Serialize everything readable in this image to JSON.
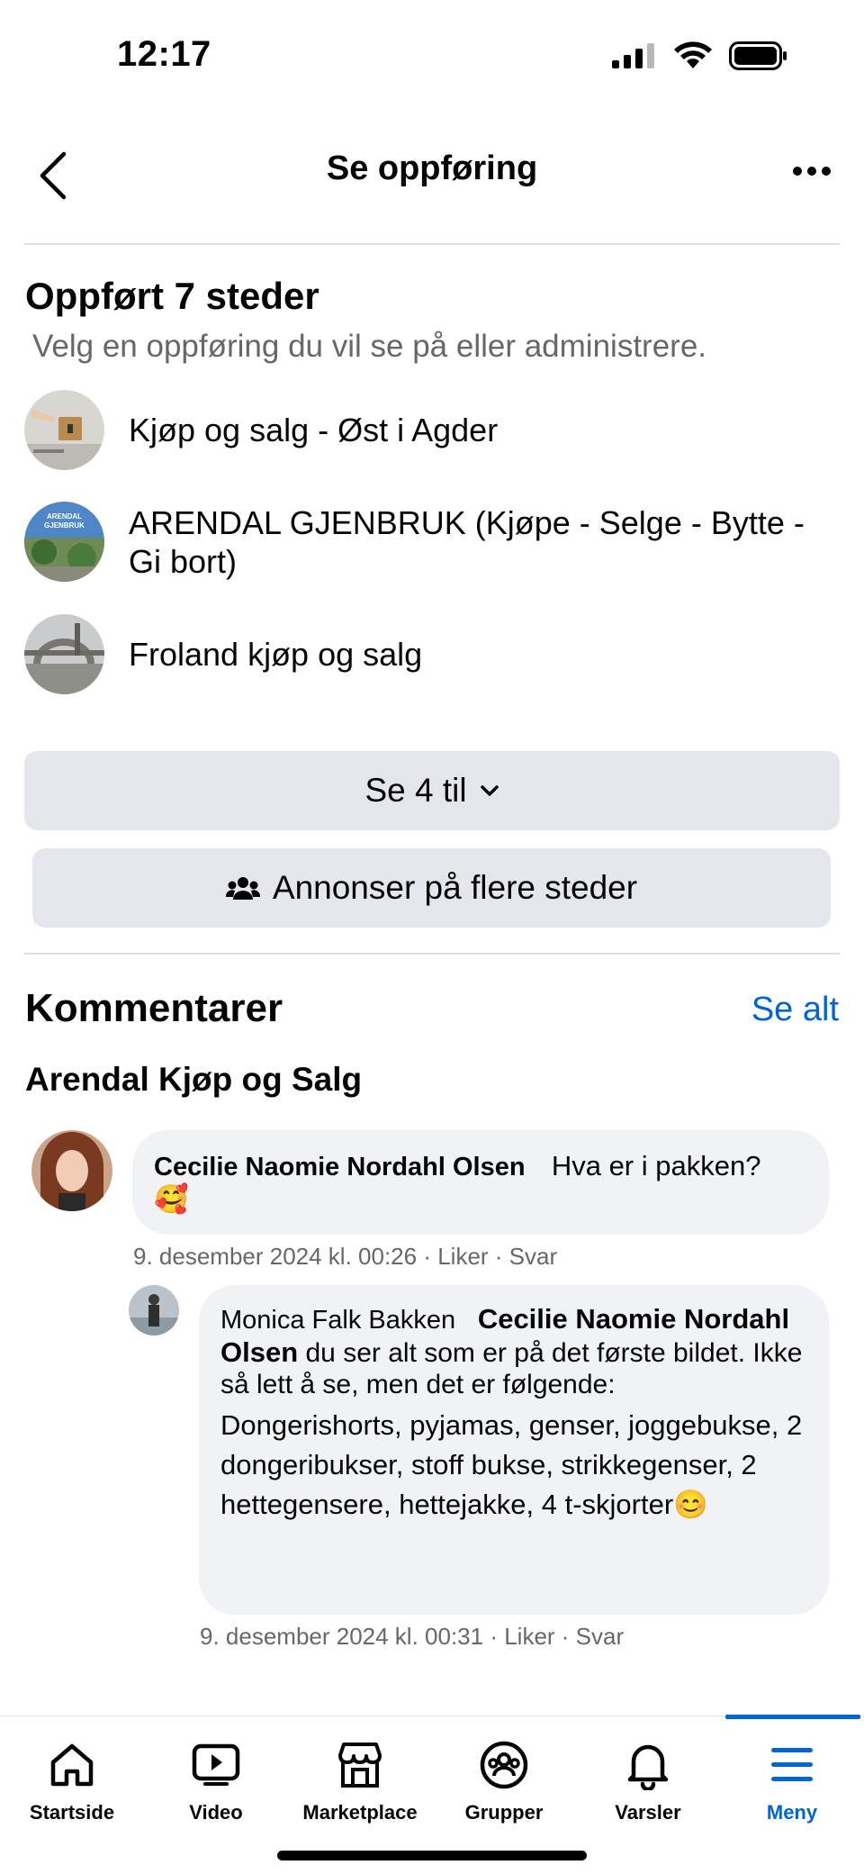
{
  "status": {
    "time": "12:17"
  },
  "header": {
    "title": "Se oppføring"
  },
  "listed": {
    "title": "Oppført 7 steder",
    "subtitle": "Velg en oppføring du vil se på eller administrere.",
    "groups": [
      {
        "name": "Kjøp og salg - Øst i Agder"
      },
      {
        "name": "ARENDAL GJENBRUK (Kjøpe - Selge - Bytte - Gi bort)",
        "avatar_text": "ARENDAL GJENBRUK"
      },
      {
        "name": "Froland kjøp og salg"
      }
    ],
    "see_more_label": "Se 4 til",
    "advertise_label": "Annonser på flere steder"
  },
  "comments": {
    "title": "Kommentarer",
    "see_all_label": "Se alt",
    "group_name": "Arendal Kjøp og Salg",
    "items": [
      {
        "author": "Cecilie Naomie Nordahl Olsen",
        "text": "Hva er i pakken?",
        "emoji": "🥰",
        "meta": "9. desember 2024 kl. 00:26 · Liker · Svar"
      },
      {
        "author": "Monica Falk Bakken",
        "mention": "Cecilie Naomie Nordahl Olsen",
        "text": "du ser alt som er på det første bildet. Ikke så lett å se, men det er følgende:",
        "text2": "Dongerishorts, pyjamas, genser, joggebukse, 2 dongeribukser, stoff bukse, strikkegenser, 2 hettegensere, hettejakke, 4 t-skjorter",
        "emoji": "😊",
        "meta": "9. desember 2024 kl. 00:31 · Liker · Svar"
      }
    ]
  },
  "bottom_nav": {
    "tabs": [
      {
        "label": "Startside",
        "icon": "home-icon"
      },
      {
        "label": "Video",
        "icon": "video-icon"
      },
      {
        "label": "Marketplace",
        "icon": "marketplace-icon"
      },
      {
        "label": "Grupper",
        "icon": "groups-icon"
      },
      {
        "label": "Varsler",
        "icon": "bell-icon"
      },
      {
        "label": "Meny",
        "icon": "menu-icon"
      }
    ],
    "active": "Meny"
  },
  "colors": {
    "accent": "#0064d1",
    "button_gray": "#e4e6eb",
    "bubble": "#f0f2f5",
    "secondary_text": "#65676b"
  }
}
